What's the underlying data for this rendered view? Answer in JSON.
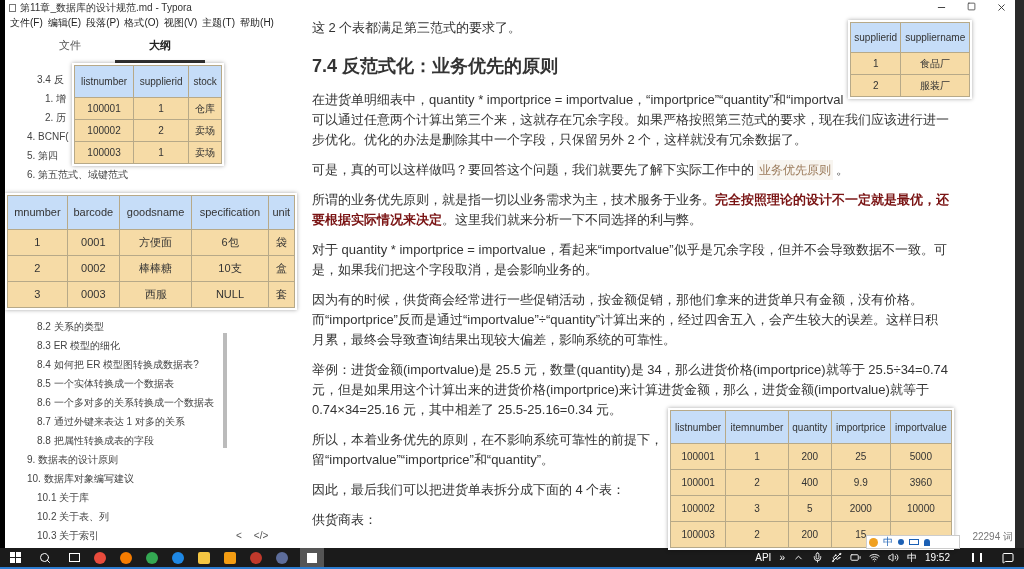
{
  "window": {
    "title": "第11章_数据库的设计规范.md - Typora"
  },
  "menu": [
    "文件(F)",
    "编辑(E)",
    "段落(P)",
    "格式(O)",
    "视图(V)",
    "主题(T)",
    "帮助(H)"
  ],
  "sidebar": {
    "tabs": [
      {
        "label": "文件",
        "selected": false
      },
      {
        "label": "大纲",
        "selected": true
      }
    ],
    "outline_sections": [
      {
        "items": [
          {
            "label": "3.4 反",
            "kind": "sub",
            "children": [
              {
                "label": "1. 增"
              },
              {
                "label": "2. 历"
              }
            ]
          },
          {
            "label": "4. BCNF(",
            "kind": "top"
          },
          {
            "label": "5. 第四",
            "kind": "top"
          },
          {
            "label": "6. 第五范式、域键范式",
            "kind": "top"
          }
        ]
      },
      {
        "items": [
          {
            "label": "8.2 关系的类型",
            "kind": "sub"
          },
          {
            "label": "8.3 ER 模型的细化",
            "kind": "sub"
          },
          {
            "label": "8.4 如何把 ER 模型图转换成数据表?",
            "kind": "sub"
          },
          {
            "label": "8.5 一个实体转换成一个数据表",
            "kind": "sub"
          },
          {
            "label": "8.6 一个多对多的关系转换成一个数据表",
            "kind": "sub"
          },
          {
            "label": "8.7 通过外键来表达 1 对多的关系",
            "kind": "sub"
          },
          {
            "label": "8.8 把属性转换成表的字段",
            "kind": "sub"
          },
          {
            "label": "9. 数据表的设计原则",
            "kind": "top"
          },
          {
            "label": "10. 数据库对象编写建议",
            "kind": "top",
            "children": [
              {
                "label": "10.1 关于库"
              },
              {
                "label": "10.2 关于表、列"
              },
              {
                "label": "10.3 关于索引"
              }
            ]
          }
        ]
      }
    ]
  },
  "document": {
    "blocks": [
      {
        "kind": "paragraph",
        "lines": [
          "这 2 个表都满足第三范式的要求了。"
        ]
      },
      {
        "kind": "heading",
        "text": "7.4 反范式化：业务优先的原则"
      },
      {
        "kind": "paragraph",
        "lines": [
          "在进货单明细表中，quantity * importprice = importvalue，“importprice”“quantity”和“importval",
          "可以通过任意两个计算出第三个来，这就存在冗余字段。如果严格按照第三范式的要求，现在我们应该进行进一",
          "步优化。优化的办法是删除其中一个字段，只保留另外 2 个，这样就没有冗余数据了。"
        ]
      },
      {
        "kind": "link_paragraph",
        "before": "可是，真的可以这样做吗？要回答这个问题，我们就要先了解下实际工作中的",
        "link": "业务优先原则",
        "after": "。"
      },
      {
        "kind": "paragraph",
        "lines": [
          "所谓的业务优先原则，就是指一切以业务需求为主，技术服务于业务。**完全按照理论的设计不一定就是最优，还**",
          "**要根据实际情况来决定**。这里我们就来分析一下不同选择的利与弊。"
        ]
      },
      {
        "kind": "paragraph",
        "lines": [
          "对于 quantity * importprice = importvalue，看起来“importvalue”似乎是冗余字段，但并不会导致数据不一致。可",
          "是，如果我们把这个字段取消，是会影响业务的。"
        ]
      },
      {
        "kind": "paragraph",
        "lines": [
          "因为有的时候，供货商会经常进行一些促销活动，按金额促销，那他们拿来的进货单只有金额，没有价格。",
          "而“importprice”反而是通过“importvalue”÷“quantity”计算出来的，经过四舍五入，会产生较大的误差。这样日积",
          "月累，最终会导致查询结果出现较大偏差，影响系统的可靠性。"
        ]
      },
      {
        "kind": "paragraph",
        "lines": [
          "举例：进货金额(importvalue)是 25.5 元，数量(quantity)是 34，那么进货价格(importprice)就等于 25.5÷34=0.74",
          "元，但是如果用这个计算出来的进货价格(importprice)来计算进货金额，那么，进货金额(importvalue)就等于",
          "0.74×34=25.16 元，其中相差了 25.5-25.16=0.34 元。"
        ]
      },
      {
        "kind": "paragraph",
        "lines": [
          "所以，本着业务优先的原则，在不影响系统可靠性的前提下，",
          "留“importvalue”“importprice”和“quantity”。"
        ]
      },
      {
        "kind": "paragraph",
        "lines": [
          "因此，最后我们可以把进货单表拆分成下面的 4 个表："
        ]
      },
      {
        "kind": "paragraph",
        "lines": [
          "供货商表："
        ]
      }
    ]
  },
  "editor_footer": [
    "<",
    "</>"
  ],
  "word_count": "22294 词",
  "pinned_tables": [
    {
      "columns": [
        "listnumber",
        "supplierid",
        "stock"
      ],
      "rows": [
        [
          "100001",
          "1",
          "仓库"
        ],
        [
          "100002",
          "2",
          "卖场"
        ],
        [
          "100003",
          "1",
          "卖场"
        ]
      ]
    },
    {
      "columns": [
        "supplierid",
        "suppliername"
      ],
      "rows": [
        [
          "1",
          "食品厂"
        ],
        [
          "2",
          "服装厂"
        ]
      ]
    },
    {
      "columns": [
        "mnumber",
        "barcode",
        "goodsname",
        "specification",
        "unit"
      ],
      "rows": [
        [
          "1",
          "0001",
          "方便面",
          "6包",
          "袋"
        ],
        [
          "2",
          "0002",
          "棒棒糖",
          "10支",
          "盒"
        ],
        [
          "3",
          "0003",
          "西服",
          "NULL",
          "套"
        ]
      ]
    },
    {
      "columns": [
        "listnumber",
        "itemnumber",
        "quantity",
        "importprice",
        "importvalue"
      ],
      "rows": [
        [
          "100001",
          "1",
          "200",
          "25",
          "5000"
        ],
        [
          "100001",
          "2",
          "400",
          "9.9",
          "3960"
        ],
        [
          "100002",
          "3",
          "5",
          "2000",
          "10000"
        ],
        [
          "100003",
          "2",
          "200",
          "15"
        ]
      ]
    }
  ],
  "ime_bar": {
    "mode": "中"
  },
  "taskbar": {
    "tray_texts": [
      "API",
      "»"
    ],
    "input_mode": "中",
    "clock": "19:52"
  }
}
